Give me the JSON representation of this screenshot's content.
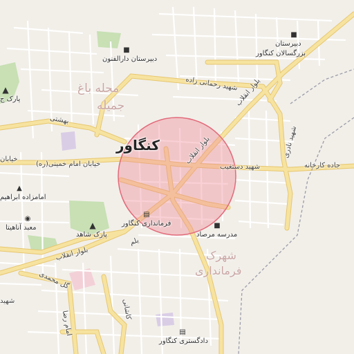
{
  "map": {
    "city_label": "کنگاور",
    "area_labels": {
      "mahalle_bagh_jamileh_line1": "محله باغ",
      "mahalle_bagh_jamileh_line2": "جمیله",
      "shahrak_line1": "شهرک",
      "shahrak_line2": "فرمانداری"
    },
    "road_labels": {
      "bolvar_enghelab_ne": "بلوار انقلاب",
      "bolvar_enghelab_center": "بلوار انقلاب",
      "bolvar_enghelab_sw": "بلوار انقلاب",
      "shahid_rahmani_zadeh": "شهید رحمانی زاده",
      "shahid_dastgheib": "شهید دستغیب",
      "jadeh_karkhaneh": "جاده کارخانه",
      "shahid_nadri": "شهید نادری",
      "khiaban_imam": "خیابان امام خمینی(ره)",
      "beheshti": "بهشتی",
      "khiaban_left": "خیابان",
      "gol_mohammadi": "گل محمدی",
      "imam_reza": "امام رضا",
      "kashani": "کاشانی",
      "yalam": "یلم",
      "shahid_left": "شهید"
    },
    "pois": {
      "dabirestan_darolfonun": "دبیرستان دارالفنون",
      "dabirestan_bozorgsalan": "دبیرستان بزرگسالان کنگاور",
      "dabirestan_bozorgsalan_line1": "دبیرستان",
      "dabirestan_bozorgsalan_line2": "بزرگسالان کنگاور",
      "park_jamileh": "پارک ج",
      "emamzadeh": "امامزاده ابراهیم",
      "mabad_anahita": "معبد آناهیتا",
      "park_shahed": "پارک شاهد",
      "farmandari": "فرمانداری کنگاور",
      "madrese_mersad": "مدرسه مرصاد",
      "dadgostari": "دادگستری کنگاور"
    },
    "icons": {
      "school": "school-icon",
      "park": "tree-icon",
      "shrine": "shrine-icon",
      "camera": "camera-icon",
      "government": "government-building-icon",
      "court": "court-building-icon"
    },
    "colors": {
      "background": "#f2efe9",
      "major_road": "#f7e3a0",
      "major_road_casing": "#e6c66e",
      "minor_road": "#ffffff",
      "park": "#c8e0b4",
      "circle_fill": "#f08a96",
      "circle_stroke": "#e26a7a",
      "boundary": "#9b9ba8",
      "purple_area": "#d9cde6"
    },
    "overlay_circle": {
      "fill_opacity": 0.4
    }
  }
}
